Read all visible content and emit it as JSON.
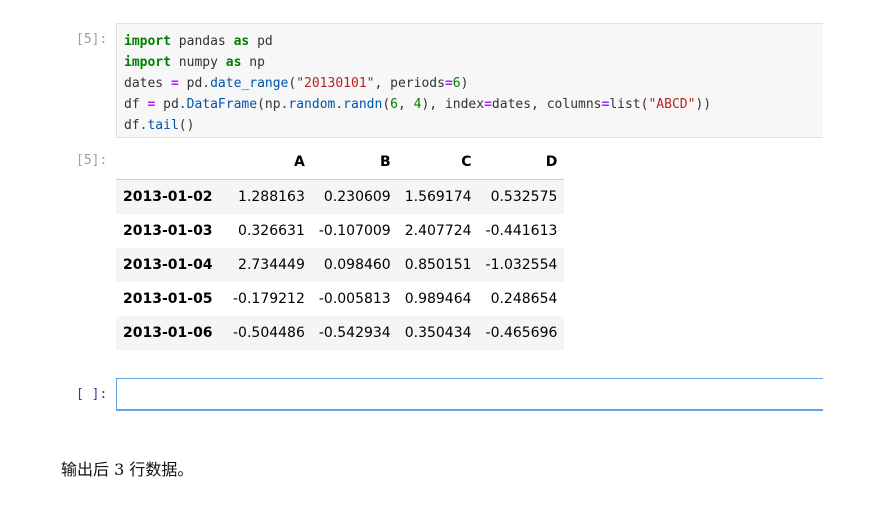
{
  "cells": [
    {
      "prompt": "[5]:",
      "code_lines": [
        [
          {
            "t": "import",
            "c": "kw"
          },
          {
            "t": " pandas "
          },
          {
            "t": "as",
            "c": "kw"
          },
          {
            "t": " pd"
          }
        ],
        [
          {
            "t": "import",
            "c": "kw"
          },
          {
            "t": " numpy "
          },
          {
            "t": "as",
            "c": "kw"
          },
          {
            "t": " np"
          }
        ],
        [
          {
            "t": "dates "
          },
          {
            "t": "=",
            "c": "op"
          },
          {
            "t": " pd"
          },
          {
            "t": ".date_range",
            "c": "attr"
          },
          {
            "t": "("
          },
          {
            "t": "\"20130101\"",
            "c": "str"
          },
          {
            "t": ", periods"
          },
          {
            "t": "=",
            "c": "op"
          },
          {
            "t": "6",
            "c": "num"
          },
          {
            "t": ")"
          }
        ],
        [
          {
            "t": "df "
          },
          {
            "t": "=",
            "c": "op"
          },
          {
            "t": " pd"
          },
          {
            "t": ".DataFrame",
            "c": "attr"
          },
          {
            "t": "(np"
          },
          {
            "t": ".random",
            "c": "attr"
          },
          {
            "t": ".randn",
            "c": "attr"
          },
          {
            "t": "("
          },
          {
            "t": "6",
            "c": "num"
          },
          {
            "t": ", "
          },
          {
            "t": "4",
            "c": "num"
          },
          {
            "t": "), index"
          },
          {
            "t": "=",
            "c": "op"
          },
          {
            "t": "dates, columns"
          },
          {
            "t": "=",
            "c": "op"
          },
          {
            "t": "list("
          },
          {
            "t": "\"ABCD\"",
            "c": "str"
          },
          {
            "t": "))"
          }
        ],
        [
          {
            "t": "df"
          },
          {
            "t": ".tail",
            "c": "attr"
          },
          {
            "t": "()"
          }
        ]
      ]
    }
  ],
  "output": {
    "prompt": "[5]:",
    "columns": [
      "A",
      "B",
      "C",
      "D"
    ],
    "rows": [
      {
        "index": "2013-01-02",
        "values": [
          "1.288163",
          "0.230609",
          "1.569174",
          "0.532575"
        ]
      },
      {
        "index": "2013-01-03",
        "values": [
          "0.326631",
          "-0.107009",
          "2.407724",
          "-0.441613"
        ]
      },
      {
        "index": "2013-01-04",
        "values": [
          "2.734449",
          "0.098460",
          "0.850151",
          "-1.032554"
        ]
      },
      {
        "index": "2013-01-05",
        "values": [
          "-0.179212",
          "-0.005813",
          "0.989464",
          "0.248654"
        ]
      },
      {
        "index": "2013-01-06",
        "values": [
          "-0.504486",
          "-0.542934",
          "0.350434",
          "-0.465696"
        ]
      }
    ]
  },
  "empty_cell": {
    "prompt": "[ ]:"
  },
  "caption": "输出后 3 行数据。"
}
